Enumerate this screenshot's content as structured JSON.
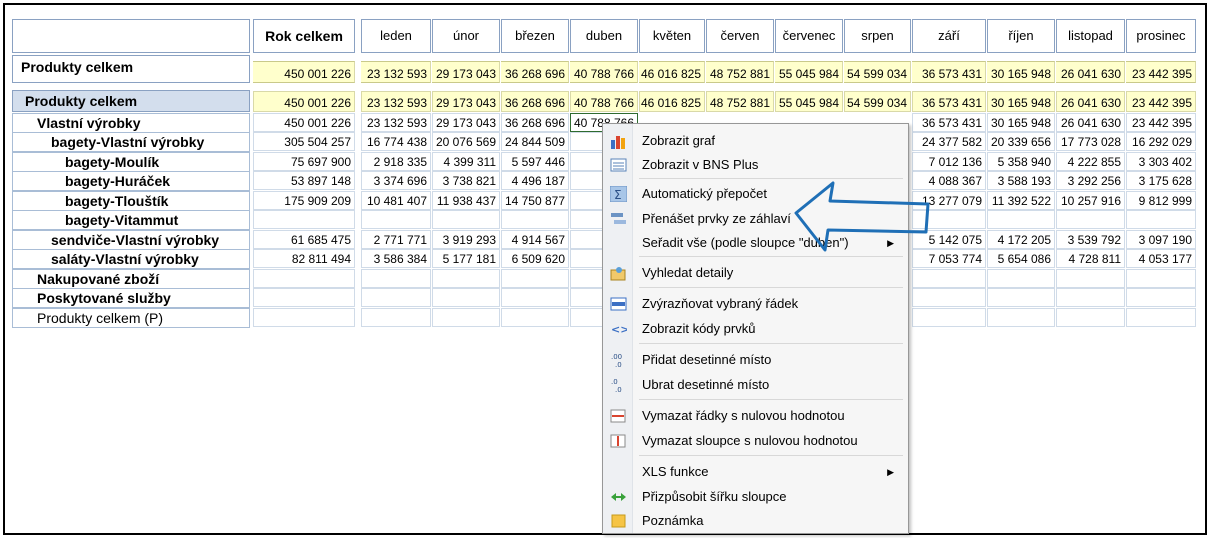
{
  "header": {
    "year_total": "Rok celkem",
    "months": [
      "leden",
      "únor",
      "březen",
      "duben",
      "květen",
      "červen",
      "červenec",
      "srpen",
      "září",
      "říjen",
      "listopad",
      "prosinec"
    ]
  },
  "summary": {
    "label": "Produkty celkem",
    "values": [
      "450 001 226",
      "23 132 593",
      "29 173 043",
      "36 268 696",
      "40 788 766",
      "46 016 825",
      "48 752 881",
      "55 045 984",
      "54 599 034",
      "36 573 431",
      "30 165 948",
      "26 041 630",
      "23 442 395"
    ]
  },
  "rows": [
    {
      "label": "Produkty celkem",
      "level": 0,
      "values": [
        "450 001 226",
        "23 132 593",
        "29 173 043",
        "36 268 696",
        "40 788 766",
        "46 016 825",
        "48 752 881",
        "55 045 984",
        "54 599 034",
        "36 573 431",
        "30 165 948",
        "26 041 630",
        "23 442 395"
      ]
    },
    {
      "label": "Vlastní výrobky",
      "level": 1,
      "values": [
        "450 001 226",
        "23 132 593",
        "29 173 043",
        "36 268 696",
        "40 788 766",
        "",
        "",
        "",
        "",
        "36 573 431",
        "30 165 948",
        "26 041 630",
        "23 442 395"
      ]
    },
    {
      "label": "bagety-Vlastní výrobky",
      "level": 2,
      "values": [
        "305 504 257",
        "16 774 438",
        "20 076 569",
        "24 844 509",
        "27 8",
        "",
        "",
        "",
        "",
        "24 377 582",
        "20 339 656",
        "17 773 028",
        "16 292 029"
      ]
    },
    {
      "label": "bagety-Moulík",
      "level": 3,
      "values": [
        "75 697 900",
        "2 918 335",
        "4 399 311",
        "5 597 446",
        "6 3",
        "",
        "",
        "",
        "",
        "7 012 136",
        "5 358 940",
        "4 222 855",
        "3 303 402"
      ]
    },
    {
      "label": "bagety-Huráček",
      "level": 3,
      "values": [
        "53 897 148",
        "3 374 696",
        "3 738 821",
        "4 496 187",
        "4 9",
        "",
        "",
        "",
        "",
        "4 088 367",
        "3 588 193",
        "3 292 256",
        "3 175 628"
      ]
    },
    {
      "label": "bagety-Tlouštík",
      "level": 3,
      "values": [
        "175 909 209",
        "10 481 407",
        "11 938 437",
        "14 750 877",
        "16 5",
        "",
        "",
        "",
        "",
        "13 277 079",
        "11 392 522",
        "10 257 916",
        "9 812 999"
      ]
    },
    {
      "label": "bagety-Vitammut",
      "level": 3,
      "values": [
        "",
        "",
        "",
        "",
        "",
        "",
        "",
        "",
        "",
        "",
        "",
        "",
        ""
      ]
    },
    {
      "label": "sendviče-Vlastní výrobky",
      "level": 2,
      "values": [
        "61 685 475",
        "2 771 771",
        "3 919 293",
        "4 914 567",
        "5 5",
        "",
        "",
        "",
        "",
        "5 142 075",
        "4 172 205",
        "3 539 792",
        "3 097 190"
      ]
    },
    {
      "label": "saláty-Vlastní výrobky",
      "level": 2,
      "values": [
        "82 811 494",
        "3 586 384",
        "5 177 181",
        "6 509 620",
        "7 3",
        "",
        "",
        "",
        "",
        "7 053 774",
        "5 654 086",
        "4 728 811",
        "4 053 177"
      ]
    },
    {
      "label": "Nakupované zboží",
      "level": 1,
      "values": [
        "",
        "",
        "",
        "",
        "",
        "",
        "",
        "",
        "",
        "",
        "",
        "",
        ""
      ]
    },
    {
      "label": "Poskytované služby",
      "level": 1,
      "values": [
        "",
        "",
        "",
        "",
        "",
        "",
        "",
        "",
        "",
        "",
        "",
        "",
        ""
      ]
    },
    {
      "label": "Produkty celkem (P)",
      "level": 9,
      "values": [
        "",
        "",
        "",
        "",
        "",
        "",
        "",
        "",
        "",
        "",
        "",
        "",
        ""
      ]
    }
  ],
  "context_menu": {
    "items": [
      {
        "label": "Zobrazit graf",
        "icon": "bar-chart-icon"
      },
      {
        "label": "Zobrazit v BNS Plus",
        "icon": "list-view-icon"
      },
      {
        "label": "Automatický přepočet",
        "icon": "sum-icon"
      },
      {
        "label": "Přenášet prvky ze záhlaví",
        "icon": "transfer-header-icon"
      },
      {
        "label": "Seřadit vše (podle sloupce \"duben\")",
        "icon": "",
        "submenu": true
      },
      {
        "label": "Vyhledat detaily",
        "icon": "search-details-icon"
      },
      {
        "label": "Zvýrazňovat vybraný řádek",
        "icon": "highlight-row-icon"
      },
      {
        "label": "Zobrazit kódy prvků",
        "icon": "code-icon"
      },
      {
        "label": "Přidat desetinné místo",
        "icon": "add-decimal-icon"
      },
      {
        "label": "Ubrat desetinné místo",
        "icon": "remove-decimal-icon"
      },
      {
        "label": "Vymazat řádky s nulovou hodnotou",
        "icon": "delete-rows-icon"
      },
      {
        "label": "Vymazat sloupce s nulovou hodnotou",
        "icon": "delete-columns-icon"
      },
      {
        "label": "XLS funkce",
        "icon": "",
        "submenu": true
      },
      {
        "label": "Přizpůsobit šířku sloupce",
        "icon": "fit-width-icon"
      },
      {
        "label": "Poznámka",
        "icon": "note-icon"
      }
    ],
    "submenu_arrow": "▶"
  },
  "colors": {
    "yellow_cell": "#ffffcc",
    "header_blue": "#d3deed",
    "annotation_arrow": "#1f6fb6"
  }
}
